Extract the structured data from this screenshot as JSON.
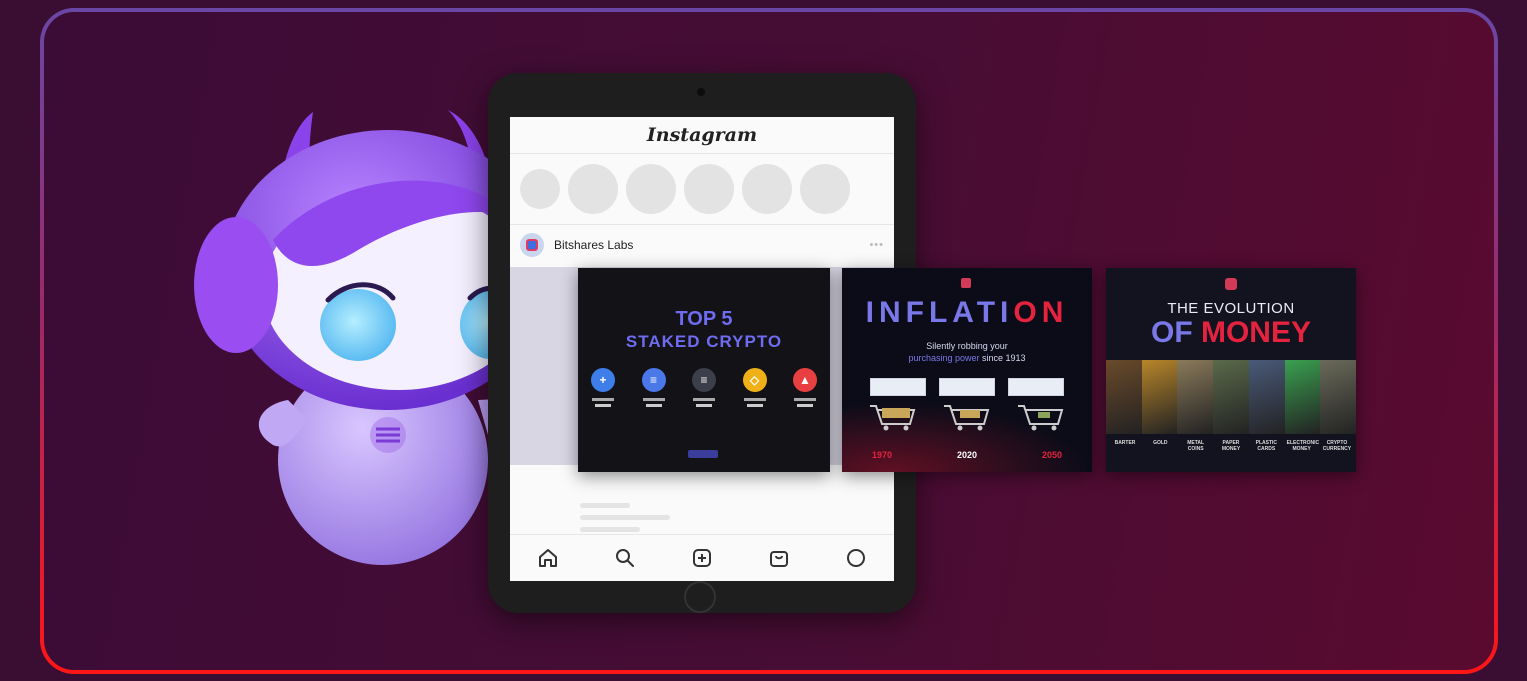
{
  "instagram": {
    "logo": "Instagram",
    "account": "Bitshares Labs",
    "more": "•••"
  },
  "cards": {
    "top5": {
      "line1": "TOP 5",
      "line2": "STAKED CRYPTO",
      "coins": [
        {
          "glyph": "+",
          "color": "#3d7ee8"
        },
        {
          "glyph": "≡",
          "color": "#4a78e8"
        },
        {
          "glyph": "≡",
          "color": "#3a3f4a"
        },
        {
          "glyph": "◇",
          "color": "#f0b018"
        },
        {
          "glyph": "▲",
          "color": "#e84040"
        }
      ]
    },
    "inflation": {
      "word_part1": "INFLATI",
      "word_part2": "ON",
      "sub_line1": "Silently robbing your",
      "sub_highlight": "purchasing power",
      "sub_line2": " since 1913",
      "years": [
        "1970",
        "2020",
        "2050"
      ],
      "year_colors": [
        "#e5233f",
        "#ffffff",
        "#e5233f"
      ]
    },
    "evolution": {
      "title_line1": "THE EVOLUTION",
      "title_w": "OF ",
      "title_r": "MONEY",
      "labels": [
        "BARTER",
        "GOLD",
        "METAL COINS",
        "PAPER MONEY",
        "PLASTIC CARDS",
        "ELECTRONIC MONEY",
        "CRYPTO CURRENCY"
      ],
      "strip_colors": [
        "#6a4a2a",
        "#b8862a",
        "#8a7a5a",
        "#5a6a4a",
        "#4a5a7a",
        "#3aa050",
        "#6a6a5a"
      ]
    }
  },
  "colors": {
    "accent_purple": "#7a78e8",
    "accent_red": "#e5233f",
    "border_top": "#6a47a6",
    "border_bottom": "#ff1616"
  }
}
